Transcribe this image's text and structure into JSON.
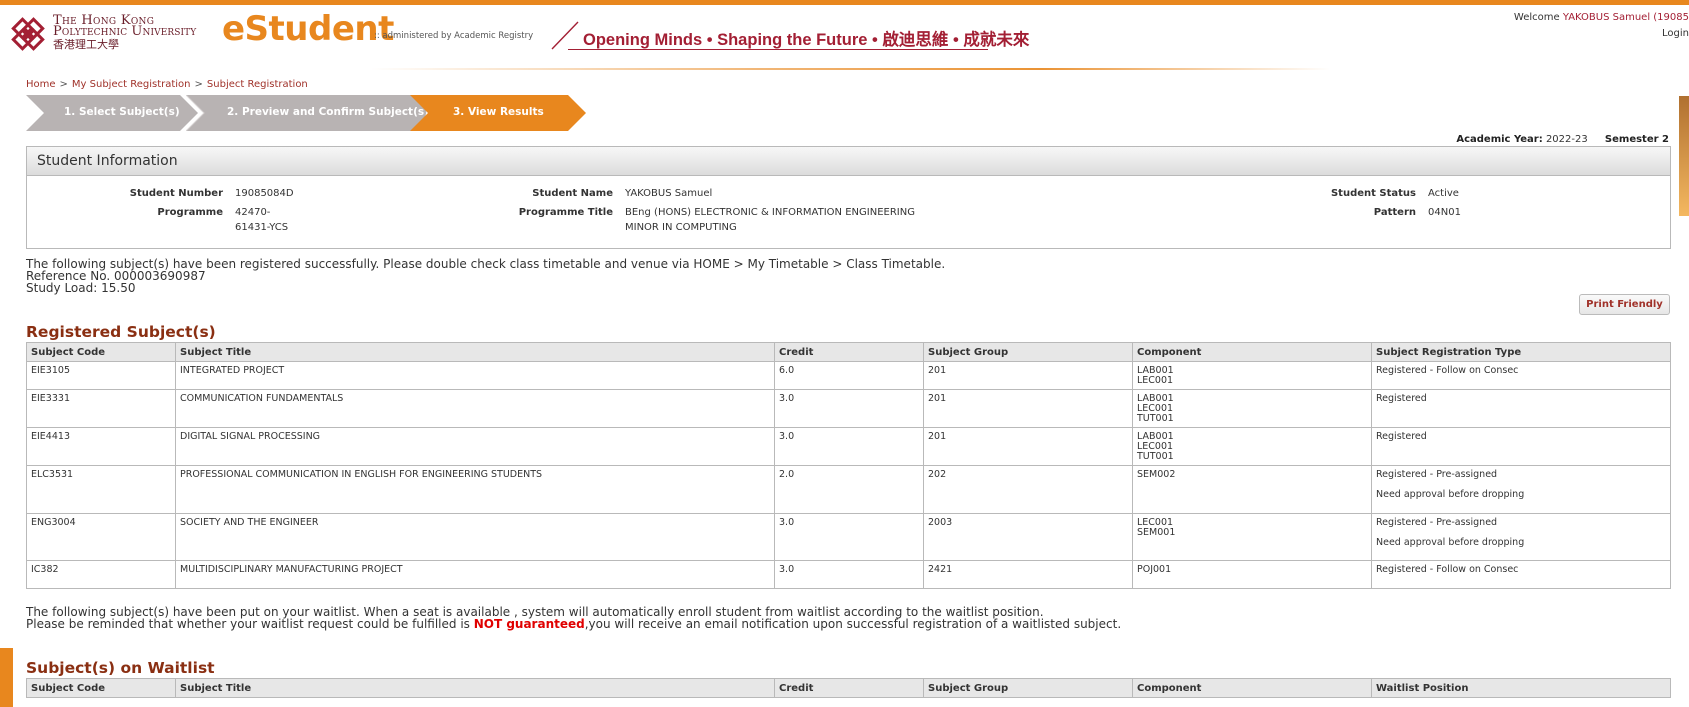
{
  "header": {
    "university_line1": "The Hong Kong",
    "university_line2": "Polytechnic University",
    "university_chinese": "香港理工大學",
    "app_name": "eStudent",
    "admin_note": ":: administered by Academic Registry",
    "slogan": "Opening Minds • Shaping the Future • 啟迪思維 • 成就未來",
    "welcome_prefix": "Welcome",
    "welcome_user": "YAKOBUS Samuel (19085",
    "login_label": "Login"
  },
  "breadcrumb": [
    "Home",
    "My Subject Registration",
    "Subject Registration"
  ],
  "steps": [
    {
      "label": "1. Select Subject(s)",
      "state": "done"
    },
    {
      "label": "2. Preview and Confirm Subject(s)",
      "state": "done"
    },
    {
      "label": "3. View Results",
      "state": "active"
    }
  ],
  "academic": {
    "year_label": "Academic Year:",
    "year_value": "2022-23",
    "semester_label": "Semester 2"
  },
  "student_info": {
    "title": "Student Information",
    "number_label": "Student Number",
    "number_value": "19085084D",
    "programme_label": "Programme",
    "programme_value_line1": "42470-",
    "programme_value_line2": "61431-YCS",
    "name_label": "Student Name",
    "name_value": "YAKOBUS Samuel",
    "programme_title_label": "Programme Title",
    "programme_title_line1": "BEng (HONS) ELECTRONIC & INFORMATION ENGINEERING",
    "programme_title_line2": "MINOR IN COMPUTING",
    "status_label": "Student Status",
    "status_value": "Active",
    "pattern_label": "Pattern",
    "pattern_value": "04N01"
  },
  "success_notice": {
    "line1": "The following subject(s) have been registered successfully. Please double check class timetable and venue via HOME > My Timetable > Class Timetable.",
    "line2": "Reference No. 000003690987",
    "line3": "Study Load: 15.50"
  },
  "print_button": "Print Friendly",
  "registered": {
    "title": "Registered Subject(s)",
    "columns": [
      "Subject Code",
      "Subject Title",
      "Credit",
      "Subject Group",
      "Component",
      "Subject Registration Type"
    ],
    "rows": [
      {
        "code": "EIE3105",
        "title": "INTEGRATED PROJECT",
        "credit": "6.0",
        "group": "201",
        "components": [
          "LAB001",
          "LEC001"
        ],
        "types": [
          "Registered - Follow on Consec"
        ]
      },
      {
        "code": "EIE3331",
        "title": "COMMUNICATION FUNDAMENTALS",
        "credit": "3.0",
        "group": "201",
        "components": [
          "LAB001",
          "LEC001",
          "TUT001"
        ],
        "types": [
          "Registered"
        ]
      },
      {
        "code": "EIE4413",
        "title": "DIGITAL SIGNAL PROCESSING",
        "credit": "3.0",
        "group": "201",
        "components": [
          "LAB001",
          "LEC001",
          "TUT001"
        ],
        "types": [
          "Registered"
        ]
      },
      {
        "code": "ELC3531",
        "title": "PROFESSIONAL COMMUNICATION IN ENGLISH FOR ENGINEERING STUDENTS",
        "credit": "2.0",
        "group": "202",
        "components": [
          "SEM002"
        ],
        "types": [
          "Registered - Pre-assigned",
          "Need approval before dropping"
        ]
      },
      {
        "code": "ENG3004",
        "title": "SOCIETY AND THE ENGINEER",
        "credit": "3.0",
        "group": "2003",
        "components": [
          "LEC001",
          "SEM001"
        ],
        "types": [
          "Registered - Pre-assigned",
          "Need approval before dropping"
        ]
      },
      {
        "code": "IC382",
        "title": "MULTIDISCIPLINARY MANUFACTURING PROJECT",
        "credit": "3.0",
        "group": "2421",
        "components": [
          "POJ001"
        ],
        "types": [
          "Registered - Follow on Consec"
        ]
      }
    ]
  },
  "waitlist_notice": {
    "line1": "The following subject(s) have been put on your waitlist. When a seat is available , system will automatically enroll student from waitlist according to the waitlist position.",
    "line2_prefix": "Please be reminded that whether your waitlist request could be fulfilled is ",
    "line2_emphasis": "NOT guaranteed",
    "line2_suffix": ",you will receive an email notification upon successful registration of a waitlisted subject."
  },
  "waitlist": {
    "title": "Subject(s) on Waitlist",
    "columns": [
      "Subject Code",
      "Subject Title",
      "Credit",
      "Subject Group",
      "Component",
      "Waitlist Position"
    ]
  },
  "colors": {
    "brand_orange": "#e8871e",
    "brand_red": "#a31f34",
    "step_inactive": "#b8b3b3",
    "section_title": "#8a2f12",
    "warning_red": "#e00000"
  }
}
